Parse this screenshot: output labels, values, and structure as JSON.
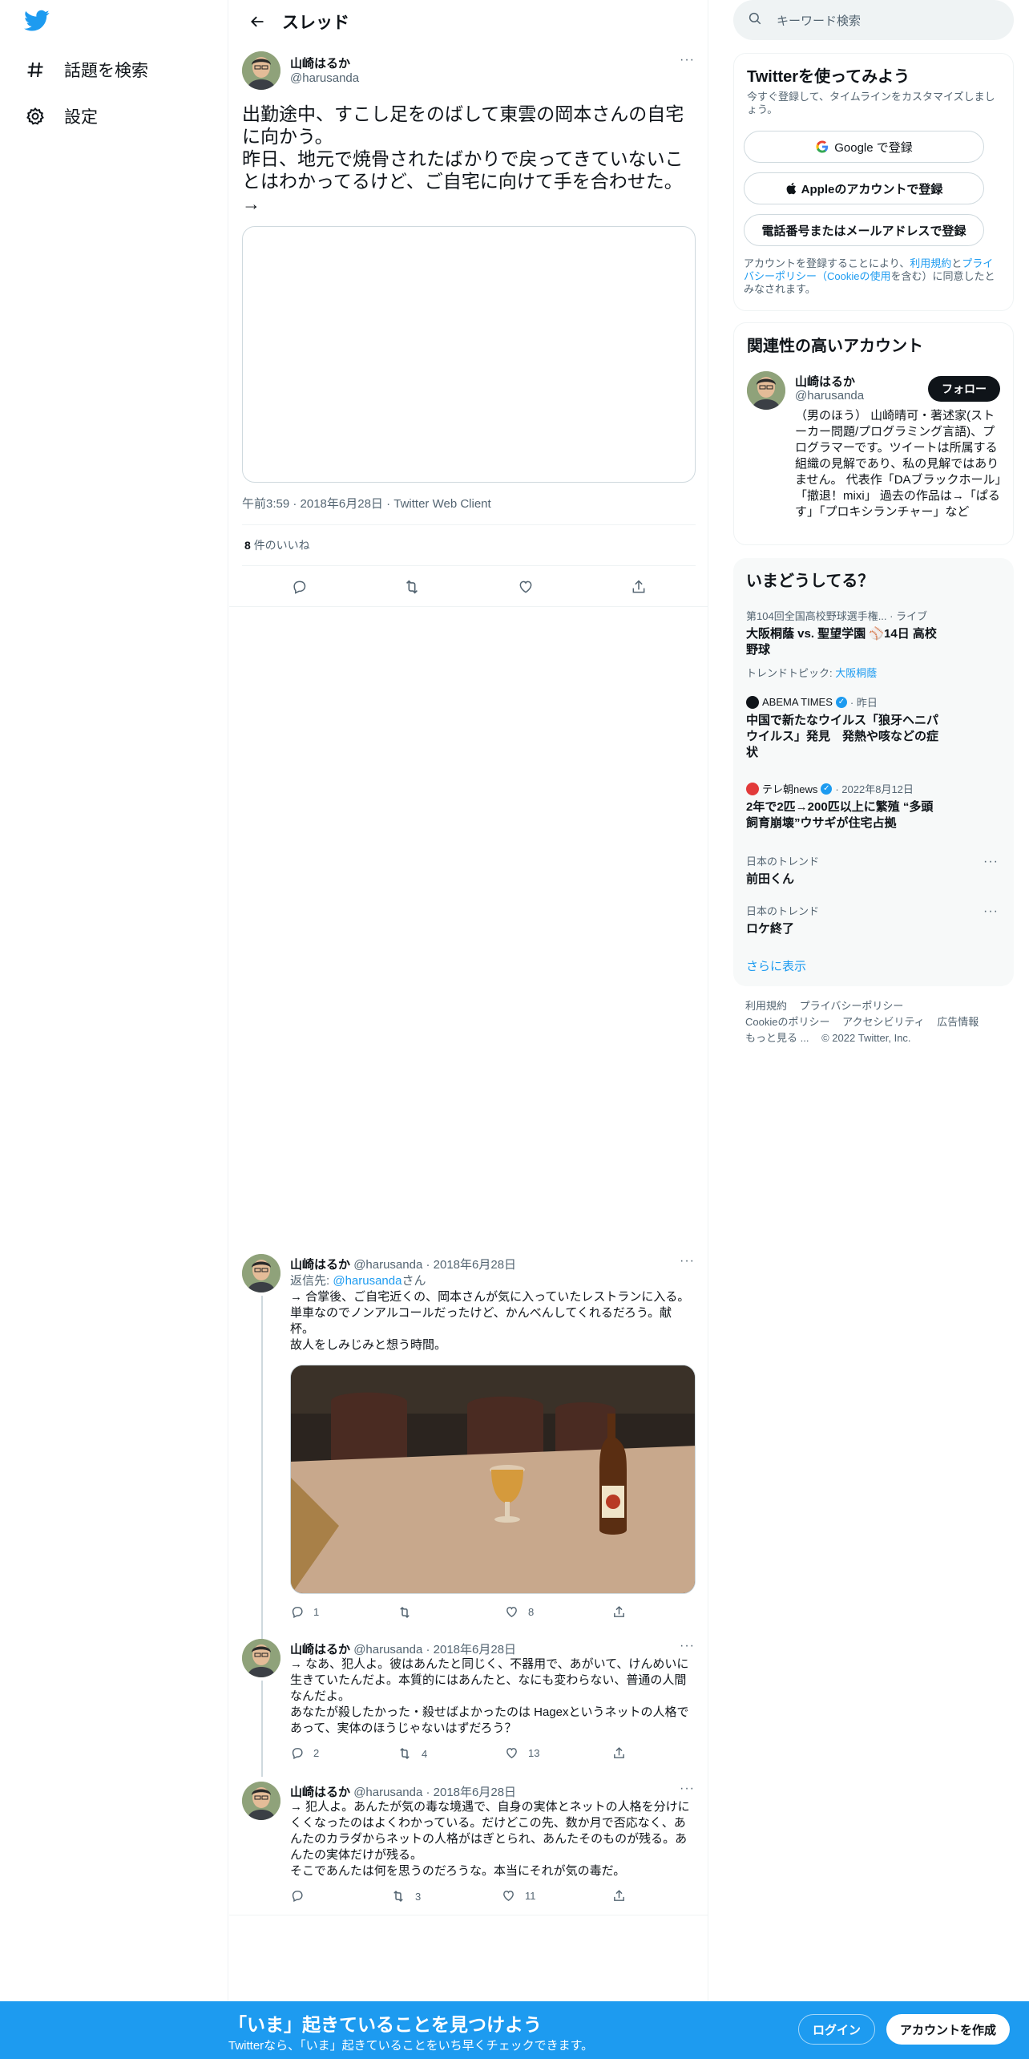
{
  "nav": {
    "explore_label": "話題を検索",
    "settings_label": "設定"
  },
  "header": {
    "title": "スレッド"
  },
  "main_tweet": {
    "name": "山崎はるか",
    "handle": "@harusanda",
    "text": "出勤途中、すこし足をのばして東雲の岡本さんの自宅に向かう。\n昨日、地元で焼骨されたばかりで戻ってきていないことはわかってるけど、ご自宅に向けて手を合わせた。→",
    "meta": "午前3:59 · 2018年6月28日 · Twitter Web Client",
    "likes_count": "8",
    "likes_label": "件のいいね"
  },
  "replies": [
    {
      "name": "山崎はるか",
      "handle": "@harusanda",
      "date": "· 2018年6月28日",
      "reply_to_label": "返信先: ",
      "reply_to_handle": "@harusanda",
      "reply_to_suffix": "さん",
      "text": "→ 合掌後、ご自宅近くの、岡本さんが気に入っていたレストランに入る。\n単車なのでノンアルコールだったけど、かんべんしてくれるだろう。献杯。\n故人をしみじみと想う時間。",
      "reply_count": "1",
      "retweet_count": "",
      "like_count": "8"
    },
    {
      "name": "山崎はるか",
      "handle": "@harusanda",
      "date": "· 2018年6月28日",
      "text": "→ なあ、犯人よ。彼はあんたと同じく、不器用で、あがいて、けんめいに生きていたんだよ。本質的にはあんたと、なにも変わらない、普通の人間なんだよ。\nあなたが殺したかった・殺せばよかったのは Hagexというネットの人格であって、実体のほうじゃないはずだろう？",
      "reply_count": "2",
      "retweet_count": "4",
      "like_count": "13"
    },
    {
      "name": "山崎はるか",
      "handle": "@harusanda",
      "date": "· 2018年6月28日",
      "text": "→ 犯人よ。あんたが気の毒な境遇で、自身の実体とネットの人格を分けにくくなったのはよくわかっている。だけどこの先、数か月で否応なく、あんたのカラダからネットの人格がはぎとられ、あんたそのものが残る。あんたの実体だけが残る。\nそこであんたは何を思うのだろうな。本当にそれが気の毒だ。",
      "reply_count": "",
      "retweet_count": "3",
      "like_count": "11"
    }
  ],
  "search": {
    "placeholder": "キーワード検索"
  },
  "signup": {
    "title": "Twitterを使ってみよう",
    "subtitle": "今すぐ登録して、タイムラインをカスタマイズしましょう。",
    "google_label": "Google で登録",
    "apple_label": "Appleのアカウントで登録",
    "phone_label": "電話番号またはメールアドレスで登録",
    "terms_pre": "アカウントを登録することにより、",
    "terms_link1": "利用規約",
    "terms_mid": "と",
    "terms_link2": "プライバシーポリシー（Cookieの使用",
    "terms_post": "を含む）に同意したとみなされます。"
  },
  "related": {
    "title": "関連性の高いアカウント",
    "name": "山崎はるか",
    "handle": "@harusanda",
    "follow_label": "フォロー",
    "bio": "（男のほう） 山崎晴可・著述家(ストーカー問題/プログラミング言語)、プログラマーです。ツイートは所属する組織の見解であり、私の見解ではありません。 代表作「DAブラックホール」「撤退！mixi」 過去の作品は→「ぱるす」「プロキシランチャー」など"
  },
  "trends": {
    "title": "いまどうしてる？",
    "items": [
      {
        "ctx": "第104回全国高校野球選手権... · ライブ",
        "title": "大阪桐蔭 vs. 聖望学園 ⚾14日 高校野球",
        "topic_pre": "トレンドトピック: ",
        "topic_link": "大阪桐蔭"
      },
      {
        "ctx_source": "ABEMA TIMES",
        "ctx_time": "· 昨日",
        "title": "中国で新たなウイルス「狼牙ヘニパウイルス」発見　発熱や咳などの症状"
      },
      {
        "ctx_source": "テレ朝news",
        "ctx_time": "· 2022年8月12日",
        "title": "2年で2匹→200匹以上に繁殖 “多頭飼育崩壊”ウサギが住宅占拠"
      },
      {
        "ctx": "日本のトレンド",
        "title": "前田くん"
      },
      {
        "ctx": "日本のトレンド",
        "title": "ロケ終了"
      }
    ],
    "show_more": "さらに表示"
  },
  "footer": {
    "terms": "利用規約",
    "privacy": "プライバシーポリシー",
    "cookie": "Cookieのポリシー",
    "accessibility": "アクセシビリティ",
    "ads": "広告情報",
    "more": "もっと見る ...",
    "copyright": "© 2022 Twitter, Inc."
  },
  "banner": {
    "title": "「いま」起きていることを見つけよう",
    "subtitle": "Twitterなら、「いま」起きていることをいち早くチェックできます。",
    "login_label": "ログイン",
    "signup_label": "アカウントを作成"
  },
  "colors": {
    "accent": "#1d9bf0",
    "text": "#0f1419",
    "muted": "#536471"
  }
}
